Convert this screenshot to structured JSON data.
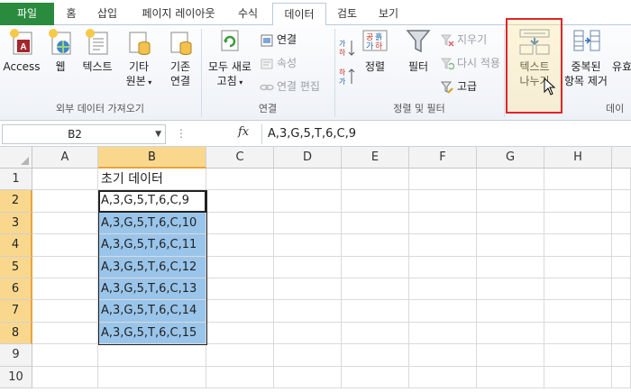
{
  "tabs": [
    {
      "label": "파일",
      "active": false
    },
    {
      "label": "홈",
      "active": false
    },
    {
      "label": "삽입",
      "active": false
    },
    {
      "label": "페이지 레이아웃",
      "active": false
    },
    {
      "label": "수식",
      "active": false
    },
    {
      "label": "데이터",
      "active": true
    },
    {
      "label": "검토",
      "active": false
    },
    {
      "label": "보기",
      "active": false
    }
  ],
  "ribbon": {
    "external": {
      "group_label": "외부 데이터 가져오기",
      "access": "Access",
      "web": "웹",
      "text": "텍스트",
      "other_1": "기타",
      "other_2": "원본",
      "existing_1": "기존",
      "existing_2": "연결"
    },
    "connections": {
      "group_label": "연결",
      "refresh_1": "모두 새로",
      "refresh_2": "고침",
      "connections": "연결",
      "properties": "속성",
      "edit_links": "연결 편집"
    },
    "sort_filter": {
      "group_label": "정렬 및 필터",
      "sort": "정렬",
      "filter": "필터",
      "clear": "지우기",
      "reapply": "다시 적용",
      "advanced": "고급"
    },
    "tools": {
      "group_label": "데이",
      "text_to_columns_1": "텍스트",
      "text_to_columns_2": "나누기",
      "remove_dup_1": "중복된",
      "remove_dup_2": "항목 제거",
      "validate": "유효"
    }
  },
  "formula_bar": {
    "name_box": "B2",
    "fx": "fx",
    "content": "A,3,G,5,T,6,C,9"
  },
  "columns": [
    "A",
    "B",
    "C",
    "D",
    "E",
    "F",
    "G",
    "H"
  ],
  "selected_column": "B",
  "rows": [
    {
      "num": "1",
      "b": "초기 데이터",
      "selected": false
    },
    {
      "num": "2",
      "b": "A,3,G,5,T,6,C,9",
      "selected": true
    },
    {
      "num": "3",
      "b": "A,3,G,5,T,6,C,10",
      "selected": true
    },
    {
      "num": "4",
      "b": "A,3,G,5,T,6,C,11",
      "selected": true
    },
    {
      "num": "5",
      "b": "A,3,G,5,T,6,C,12",
      "selected": true
    },
    {
      "num": "6",
      "b": "A,3,G,5,T,6,C,13",
      "selected": true
    },
    {
      "num": "7",
      "b": "A,3,G,5,T,6,C,14",
      "selected": true
    },
    {
      "num": "8",
      "b": "A,3,G,5,T,6,C,15",
      "selected": true
    },
    {
      "num": "9",
      "b": "",
      "selected": false
    },
    {
      "num": "10",
      "b": "",
      "selected": false
    }
  ],
  "colors": {
    "file_tab": "#2a8a3e",
    "selection_fill": "#9ac5ea",
    "header_selected": "#f9d88e",
    "highlight_box": "#e0242b"
  }
}
